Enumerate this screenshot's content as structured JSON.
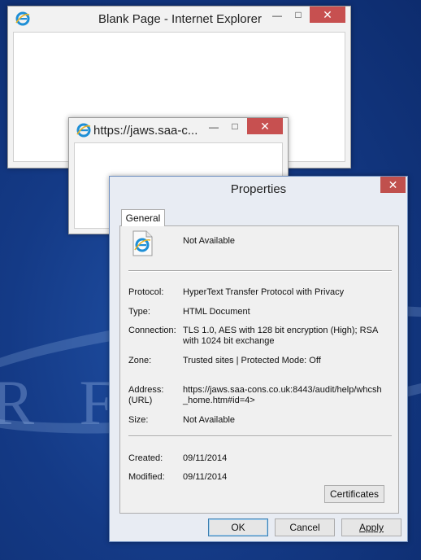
{
  "window1": {
    "title": "Blank Page - Internet Explorer",
    "minimize": "—",
    "maximize": "□",
    "close": "✕"
  },
  "window2": {
    "title": "https://jaws.saa-c...",
    "minimize": "—",
    "maximize": "□",
    "close": "✕"
  },
  "dialog": {
    "title": "Properties",
    "close": "✕",
    "tab": "General",
    "name": "Not Available",
    "rows": {
      "protocol_label": "Protocol:",
      "protocol_value": "HyperText Transfer Protocol with Privacy",
      "type_label": "Type:",
      "type_value": "HTML Document",
      "connection_label": "Connection:",
      "connection_value": "TLS 1.0, AES with 128 bit encryption (High); RSA with 1024 bit exchange",
      "zone_label": "Zone:",
      "zone_value": "Trusted sites | Protected Mode: Off",
      "address_label": "Address: (URL)",
      "address_value": "https://jaws.saa-cons.co.uk:8443/audit/help/whcsh_home.htm#id=4>",
      "size_label": "Size:",
      "size_value": "Not Available",
      "created_label": "Created:",
      "created_value": "09/11/2014",
      "modified_label": "Modified:",
      "modified_value": "09/11/2014"
    },
    "certificates_button": "Certificates",
    "ok_button": "OK",
    "cancel_button": "Cancel",
    "apply_button": "Apply"
  }
}
